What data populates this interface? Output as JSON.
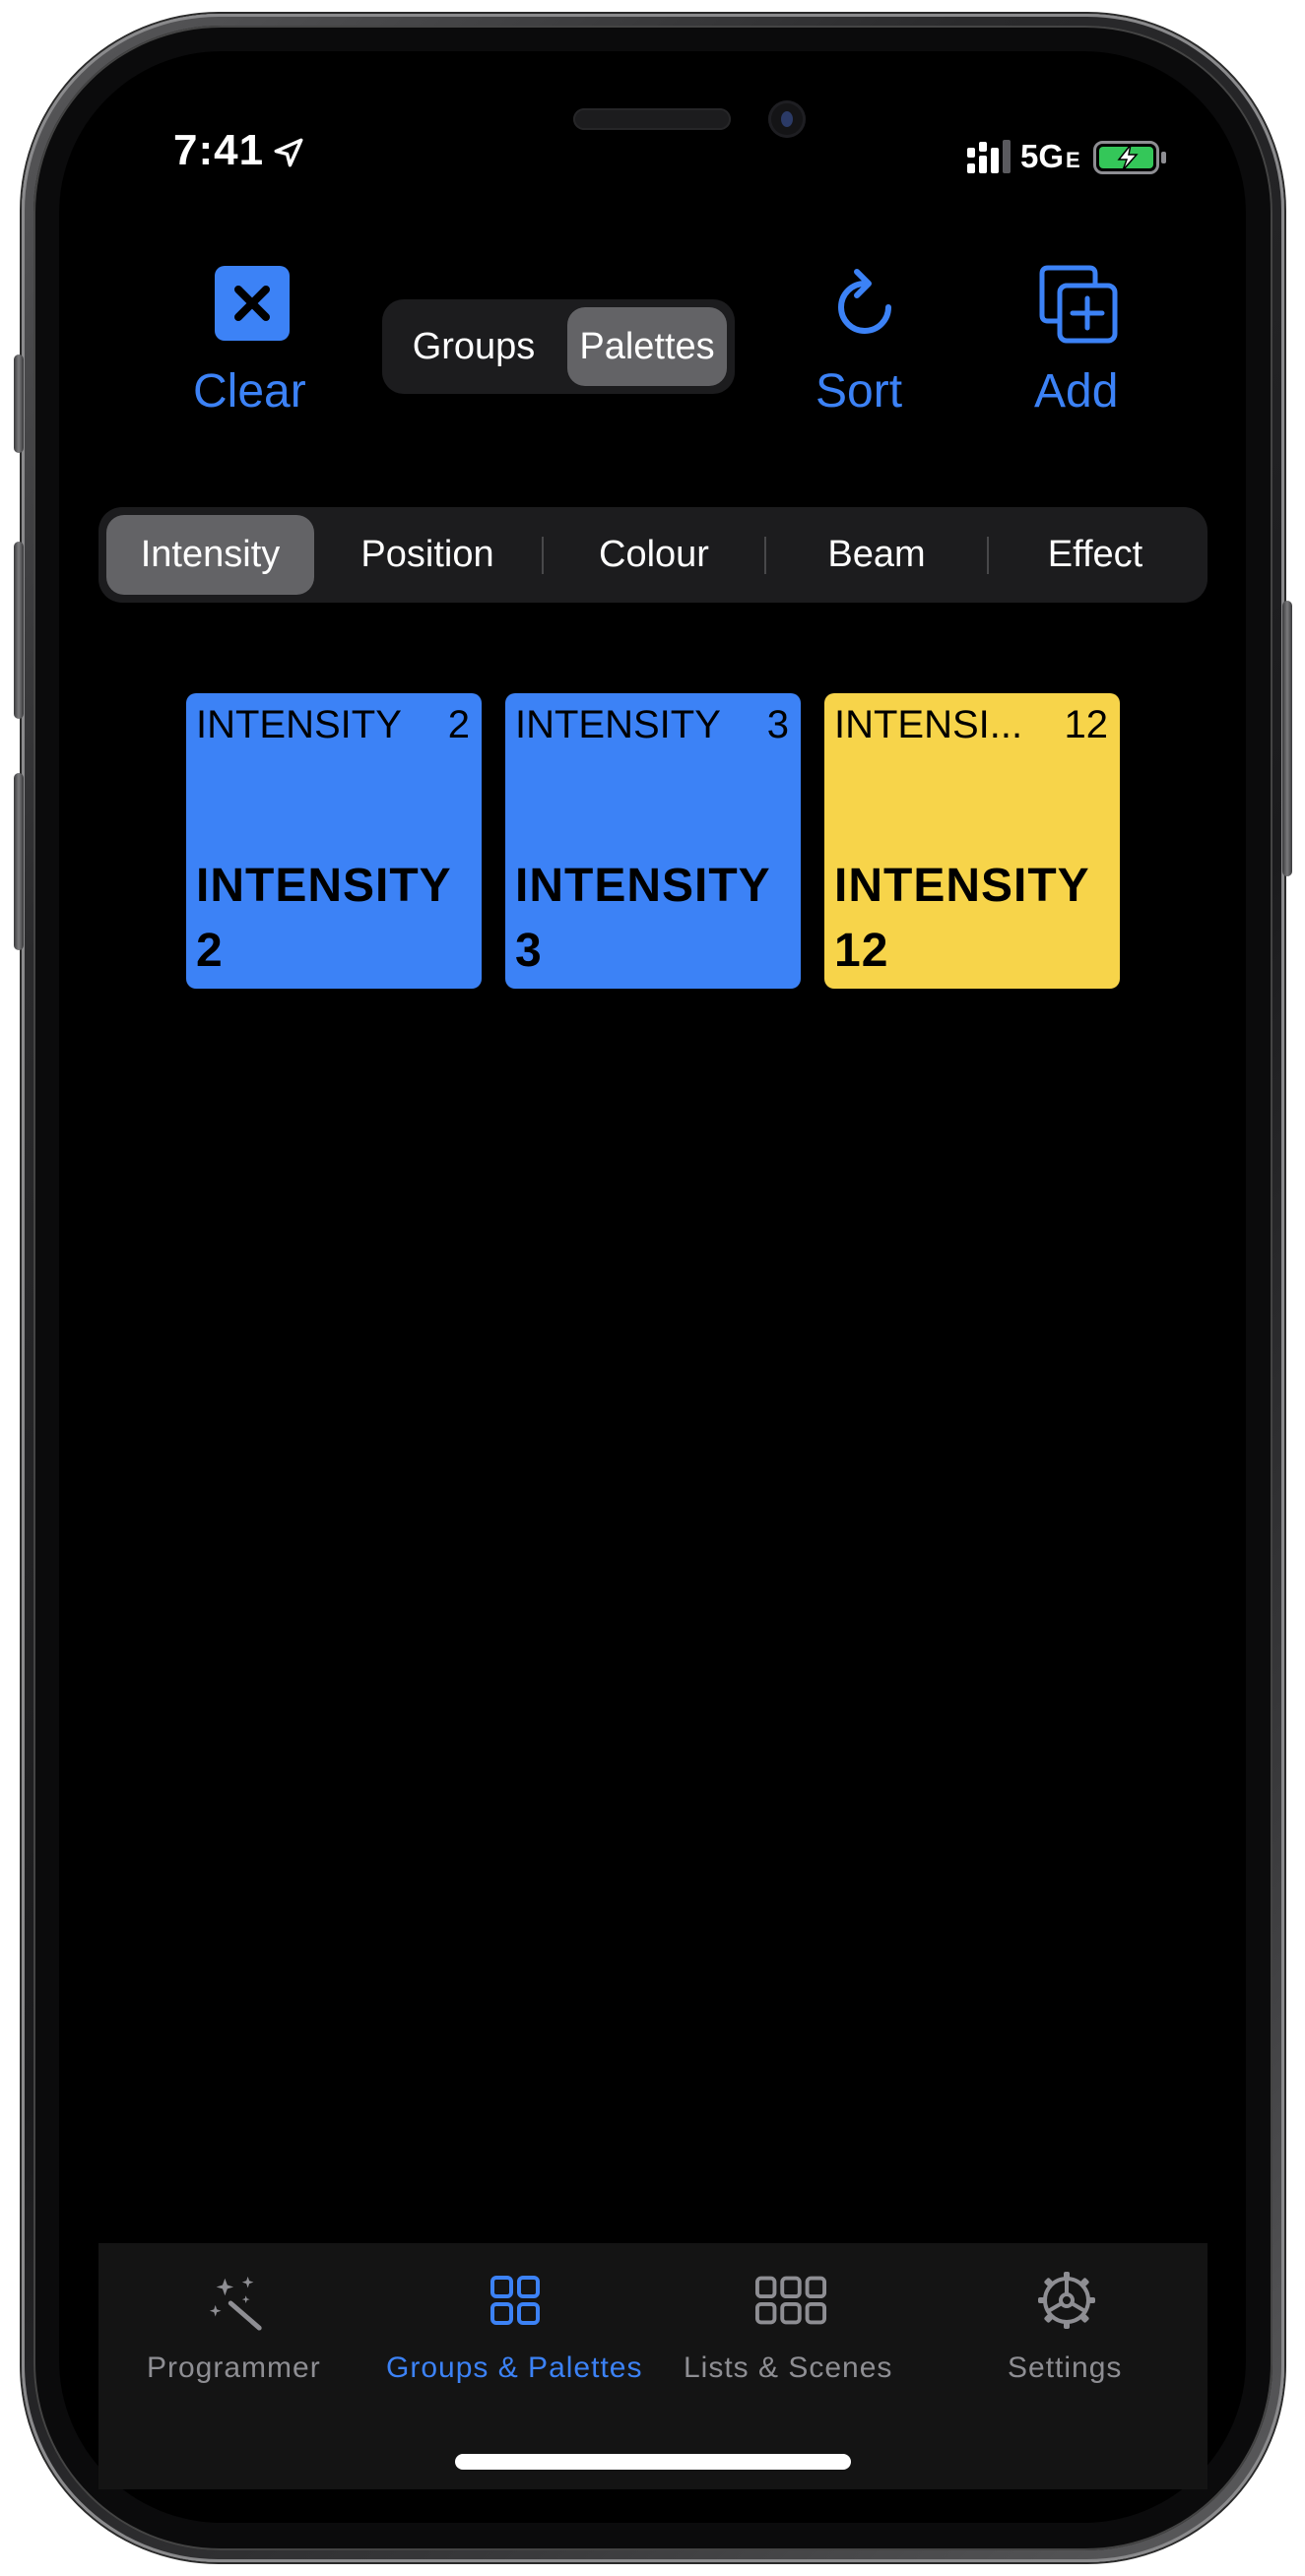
{
  "status_bar": {
    "time": "7:41",
    "network": "5G",
    "network_suffix": "E"
  },
  "toolbar": {
    "clear_label": "Clear",
    "sort_label": "Sort",
    "add_label": "Add",
    "mode_options": [
      "Groups",
      "Palettes"
    ],
    "mode_selected": "Palettes"
  },
  "categories": {
    "options": [
      "Intensity",
      "Position",
      "Colour",
      "Beam",
      "Effect"
    ],
    "selected": "Intensity"
  },
  "palettes": [
    {
      "type": "INTENSITY",
      "number": "2",
      "name_line1": "INTENSITY",
      "name_line2": "2",
      "color": "#3c82f6"
    },
    {
      "type": "INTENSITY",
      "number": "3",
      "name_line1": "INTENSITY",
      "name_line2": "3",
      "color": "#3c82f6"
    },
    {
      "type": "INTENSI...",
      "number": "12",
      "name_line1": "INTENSITY",
      "name_line2": "12",
      "color": "#f7d44a"
    }
  ],
  "tab_bar": {
    "tabs": [
      "Programmer",
      "Groups & Palettes",
      "Lists & Scenes",
      "Settings"
    ],
    "selected": "Groups & Palettes"
  },
  "colors": {
    "accent": "#3c82f6",
    "inactive": "#8e8e93",
    "background": "#000000"
  }
}
